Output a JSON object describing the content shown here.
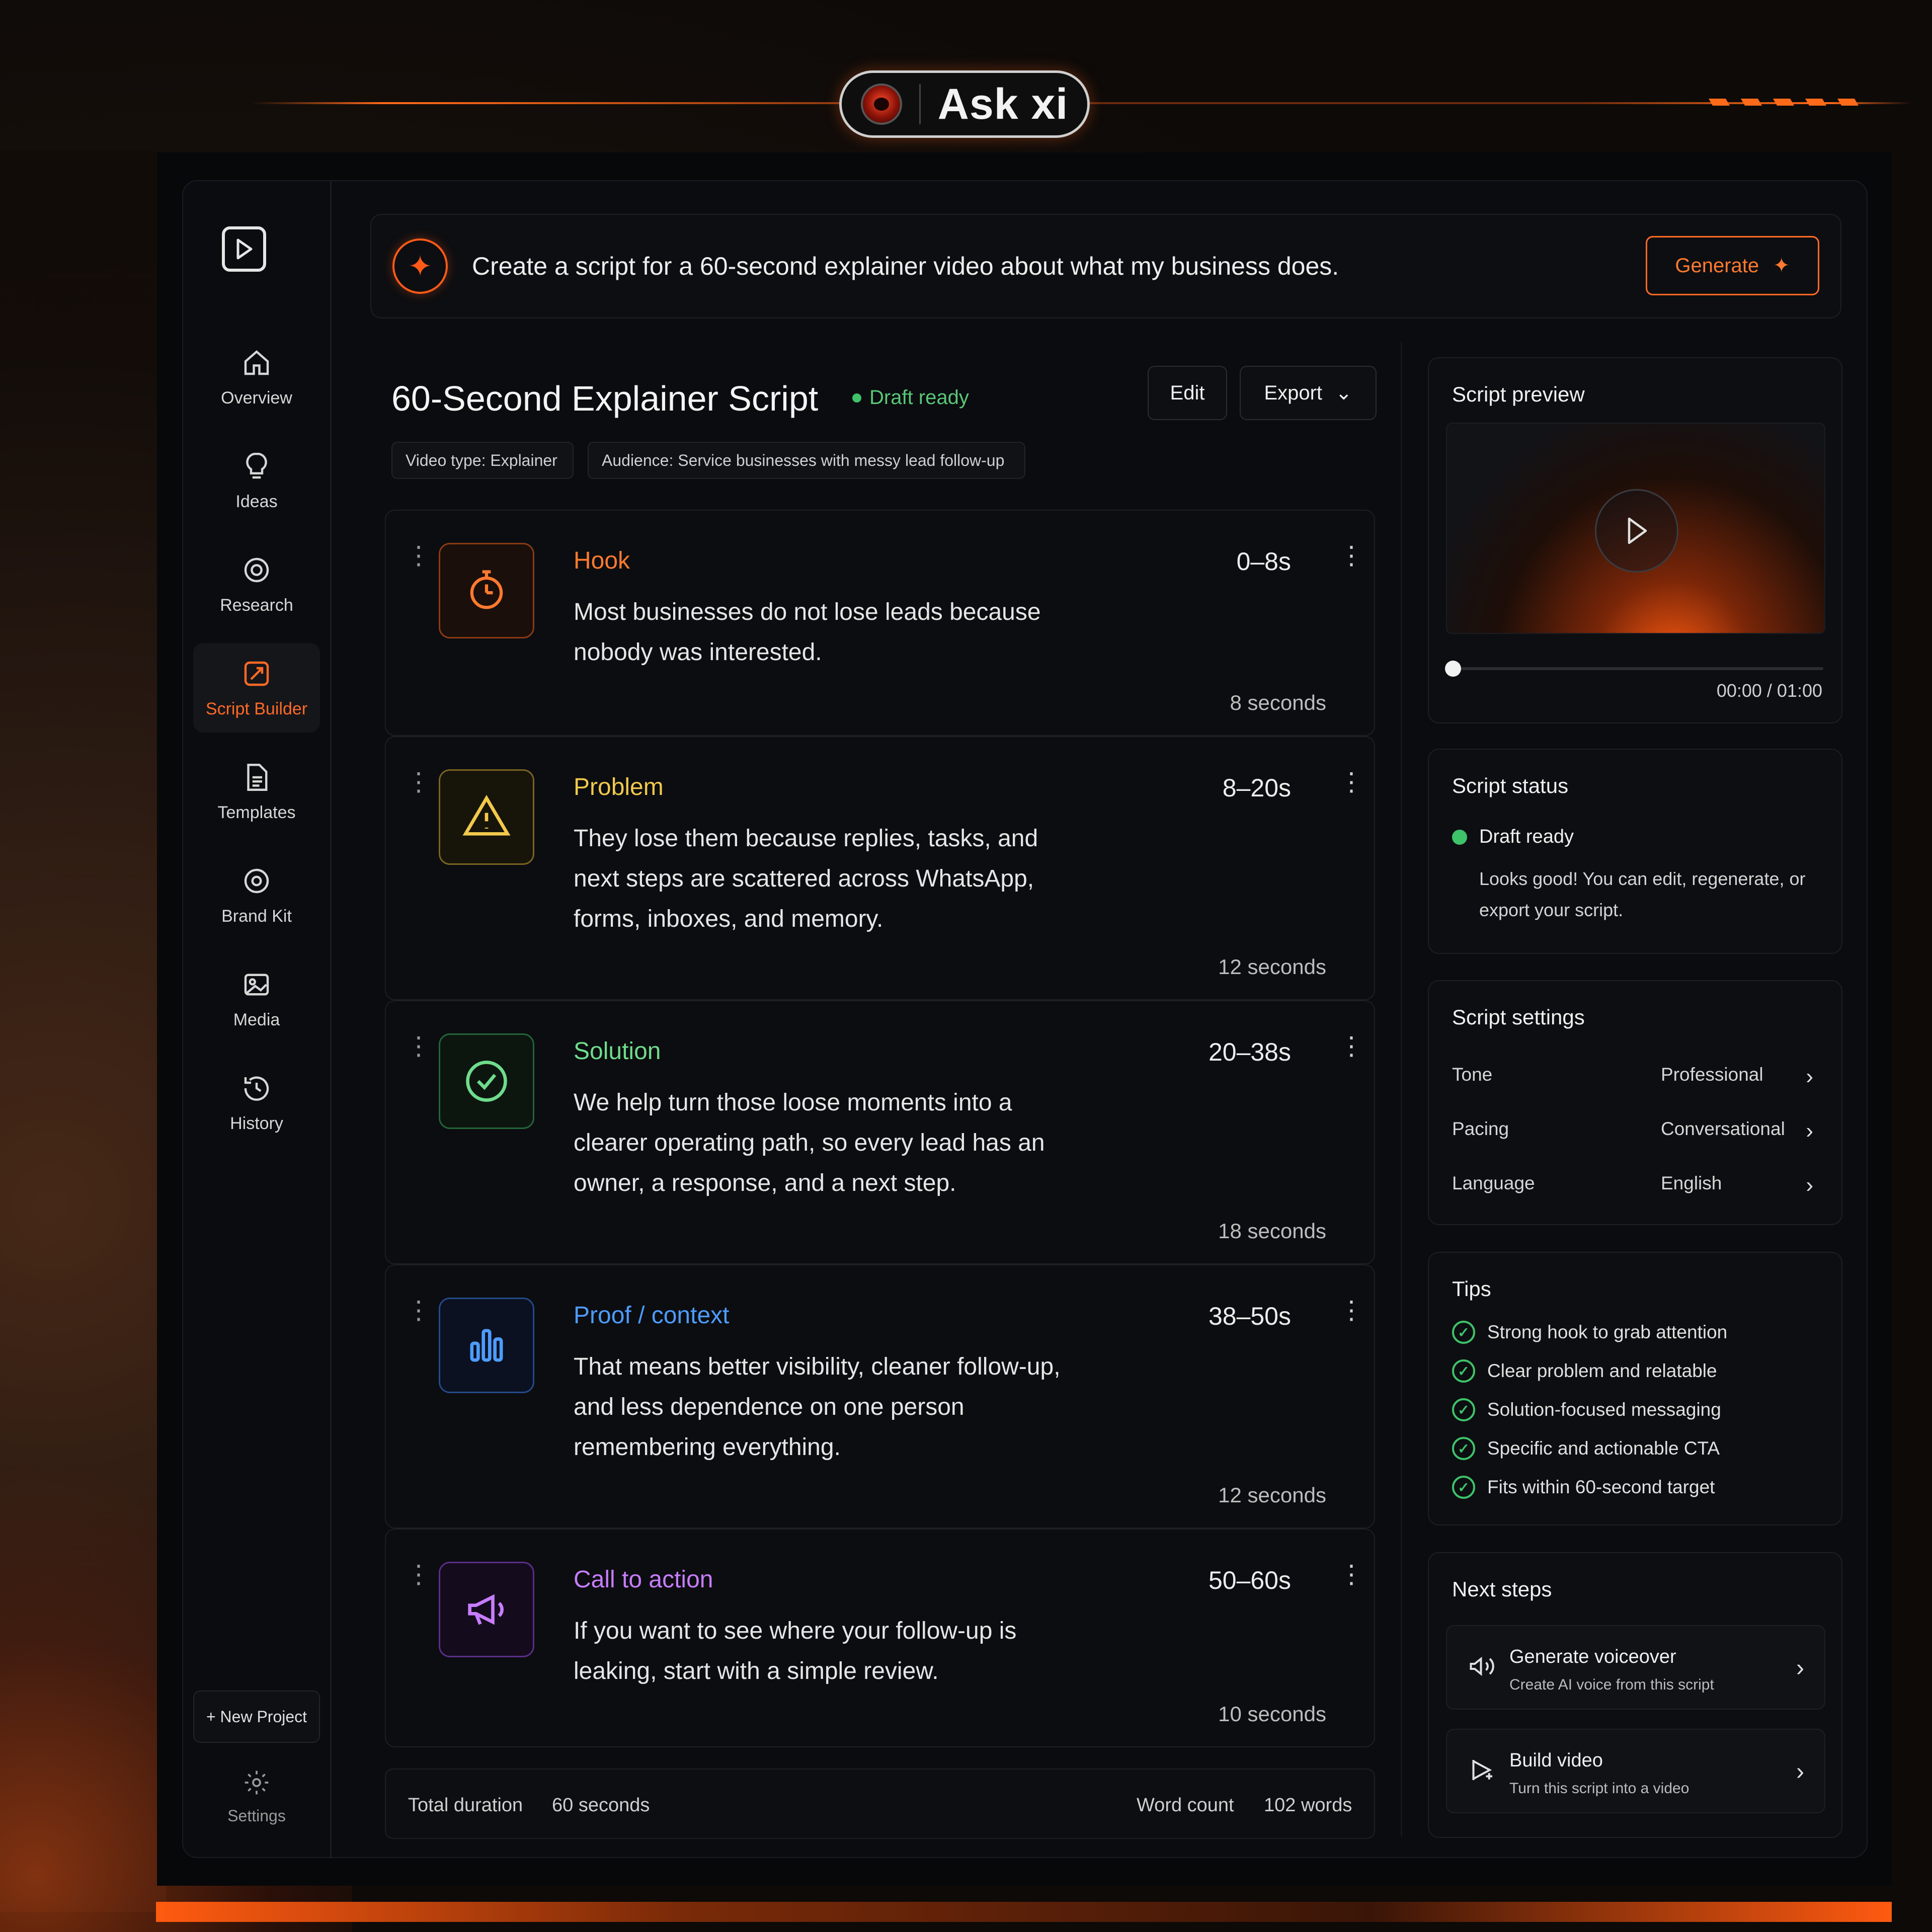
{
  "brand": {
    "name": "Ask xi"
  },
  "sidebar": {
    "items": [
      {
        "label": "Overview",
        "icon": "home-icon"
      },
      {
        "label": "Ideas",
        "icon": "lightbulb-icon"
      },
      {
        "label": "Research",
        "icon": "research-icon"
      },
      {
        "label": "Script Builder",
        "icon": "script-builder-icon",
        "active": true
      },
      {
        "label": "Templates",
        "icon": "document-icon"
      },
      {
        "label": "Brand Kit",
        "icon": "brand-kit-icon"
      },
      {
        "label": "Media",
        "icon": "image-icon"
      },
      {
        "label": "History",
        "icon": "history-icon"
      }
    ],
    "new_project": "+ New Project",
    "settings": "Settings"
  },
  "prompt": {
    "text": "Create a script for a 60-second explainer video about what my business does.",
    "generate": "Generate"
  },
  "script": {
    "title": "60-Second Explainer Script",
    "status": "Draft ready",
    "edit": "Edit",
    "export": "Export",
    "tags": [
      "Video type: Explainer",
      "Audience: Service businesses with messy lead follow-up"
    ]
  },
  "sections": [
    {
      "title": "Hook",
      "time": "0–8s",
      "body": "Most businesses do not lose leads because nobody was interested.",
      "duration": "8 seconds",
      "color": "#ff7a30",
      "icon": "timer-icon"
    },
    {
      "title": "Problem",
      "time": "8–20s",
      "body": "They lose them because replies, tasks, and next steps are scattered across WhatsApp, forms, inboxes, and memory.",
      "duration": "12 seconds",
      "color": "#f2c94c",
      "icon": "warning-icon"
    },
    {
      "title": "Solution",
      "time": "20–38s",
      "body": "We help turn those loose moments into a clearer operating path, so every lead has an owner, a response, and a next step.",
      "duration": "18 seconds",
      "color": "#6fdc8c",
      "icon": "check-circle-icon"
    },
    {
      "title": "Proof / context",
      "time": "38–50s",
      "body": "That means better visibility, cleaner follow-up, and less dependence on one person remembering everything.",
      "duration": "12 seconds",
      "color": "#4d9cff",
      "icon": "bar-chart-icon"
    },
    {
      "title": "Call to action",
      "time": "50–60s",
      "body": "If you want to see where your follow-up is leaking, start with a simple review.",
      "duration": "10 seconds",
      "color": "#c77dff",
      "icon": "megaphone-icon"
    }
  ],
  "totals": {
    "duration_label": "Total duration",
    "duration_value": "60 seconds",
    "words_label": "Word count",
    "words_value": "102 words"
  },
  "preview": {
    "title": "Script preview",
    "time": "00:00 / 01:00",
    "progress": 0
  },
  "status_panel": {
    "title": "Script status",
    "status": "Draft ready",
    "desc": "Looks good! You can edit, regenerate, or export your script."
  },
  "settings_panel": {
    "title": "Script settings",
    "rows": [
      {
        "label": "Tone",
        "value": "Professional"
      },
      {
        "label": "Pacing",
        "value": "Conversational"
      },
      {
        "label": "Language",
        "value": "English"
      }
    ]
  },
  "tips": {
    "title": "Tips",
    "items": [
      "Strong hook to grab attention",
      "Clear problem and relatable",
      "Solution-focused messaging",
      "Specific and actionable CTA",
      "Fits within 60-second target"
    ]
  },
  "next_steps": {
    "title": "Next steps",
    "items": [
      {
        "title": "Generate voiceover",
        "desc": "Create AI voice from this script"
      },
      {
        "title": "Build video",
        "desc": "Turn this script into a video"
      }
    ]
  },
  "colors": {
    "accent": "#ff6a25",
    "success": "#3ec26a",
    "background": "#0b0c0f"
  }
}
